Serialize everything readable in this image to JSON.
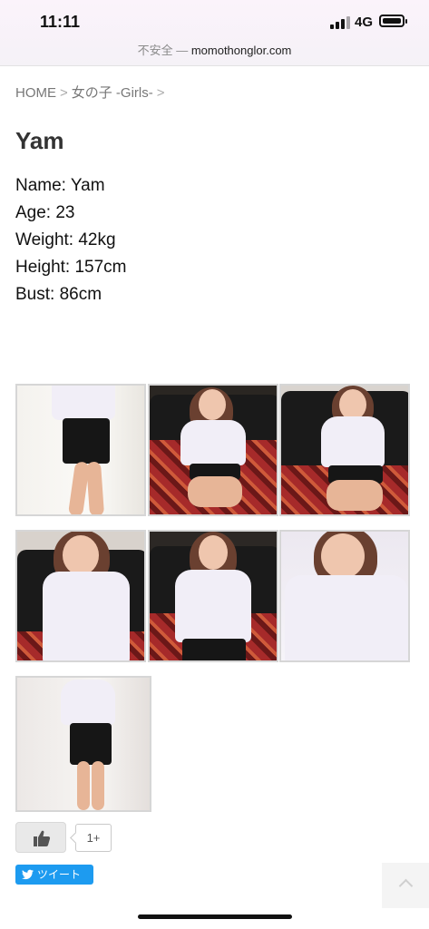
{
  "status_bar": {
    "time": "11:11",
    "network": "4G"
  },
  "browser": {
    "insecure_label": "不安全 — ",
    "domain": "momothonglor.com"
  },
  "breadcrumb": {
    "home": "HOME",
    "category": "女の子 -Girls-",
    "separator": ">"
  },
  "profile": {
    "title": "Yam",
    "fields": [
      "Name: Yam",
      "Age: 23",
      "Weight: 42kg",
      "Height: 157cm",
      "Bust: 86cm"
    ]
  },
  "gallery": {
    "photo_count": 7,
    "photos": [
      "standing-full-body-photo",
      "seated-on-sofa-photo",
      "seated-on-sofa-smiling-photo",
      "closeup-on-sofa-photo",
      "seated-on-sofa-closeup-photo",
      "selfie-closeup-photo",
      "standing-crossed-arms-photo"
    ]
  },
  "social": {
    "like_icon": "thumbs-up-icon",
    "like_count": "1+",
    "tweet_label": "ツイート",
    "tweet_icon": "twitter-bird-icon"
  },
  "scroll_top_icon": "chevron-up-icon"
}
